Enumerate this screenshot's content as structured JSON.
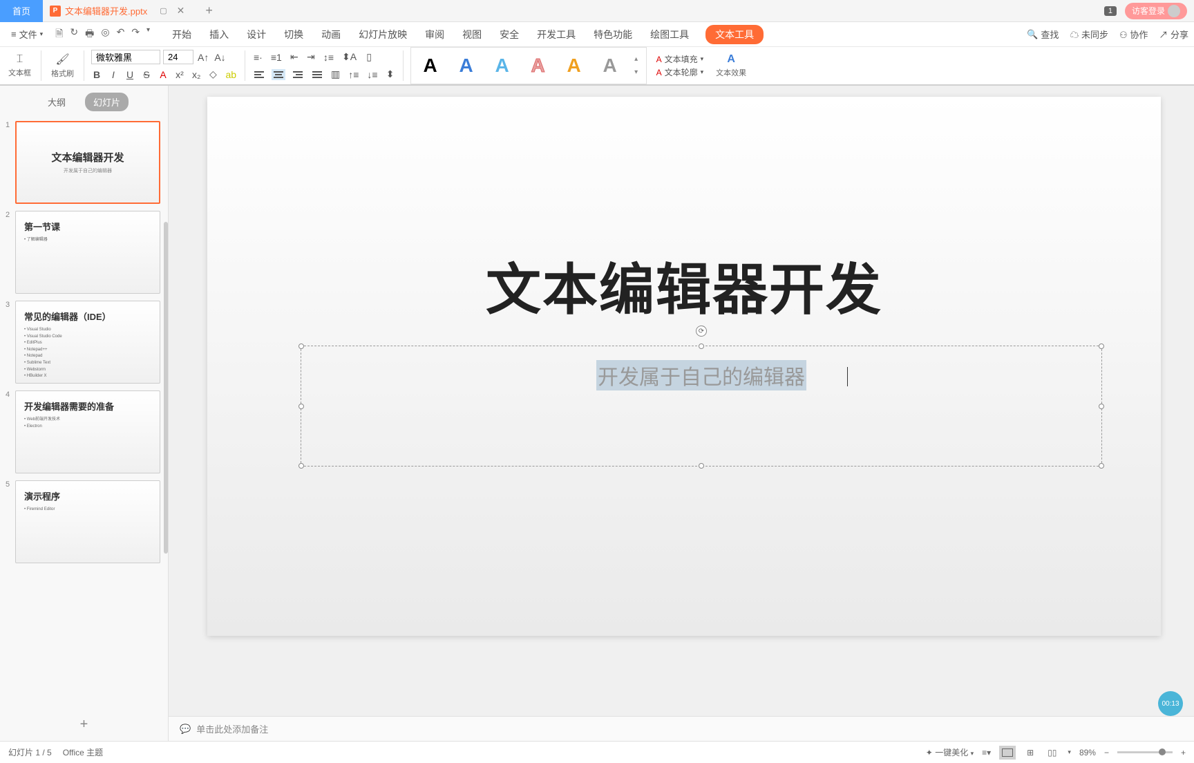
{
  "titlebar": {
    "home": "首页",
    "filename": "文本编辑器开发.pptx",
    "badge": "1",
    "login": "访客登录"
  },
  "menubar": {
    "file": "文件",
    "items": [
      "开始",
      "插入",
      "设计",
      "切换",
      "动画",
      "幻灯片放映",
      "审阅",
      "视图",
      "安全",
      "开发工具",
      "特色功能",
      "绘图工具",
      "文本工具"
    ],
    "search": "查找",
    "sync": "未同步",
    "collab": "协作",
    "share": "分享"
  },
  "toolbar": {
    "textbox": "文本框",
    "format_painter": "格式刷",
    "font_name": "微软雅黑",
    "font_size": "24",
    "text_fill": "文本填充",
    "text_outline": "文本轮廓",
    "text_effects": "文本效果"
  },
  "sidebar": {
    "outline": "大纲",
    "slides": "幻灯片",
    "thumbs": [
      {
        "num": "1",
        "title": "文本编辑器开发",
        "sub": "开发属于自己的编辑器",
        "active": true,
        "layout": "title"
      },
      {
        "num": "2",
        "title": "第一节课",
        "bullets": [
          "• 了解编辑器"
        ],
        "layout": "content"
      },
      {
        "num": "3",
        "title": "常见的编辑器（IDE）",
        "bullets": [
          "• Visual Studio",
          "• Visual Studio Code",
          "• EditPlus",
          "• Notepad++",
          "• Notepad",
          "• Sublime Text",
          "• Webstorm",
          "• HBuilder X"
        ],
        "layout": "content"
      },
      {
        "num": "4",
        "title": "开发编辑器需要的准备",
        "bullets": [
          "• Web前端开发技术",
          "• Electron"
        ],
        "layout": "content"
      },
      {
        "num": "5",
        "title": "演示程序",
        "bullets": [
          "• Firemind Editor"
        ],
        "layout": "content"
      }
    ]
  },
  "slide": {
    "title": "文本编辑器开发",
    "subtitle": "开发属于自己的编辑器"
  },
  "notes": {
    "placeholder": "单击此处添加备注"
  },
  "statusbar": {
    "slide_info": "幻灯片 1 / 5",
    "theme": "Office 主题",
    "beautify": "一键美化",
    "zoom": "89%",
    "timer": "00:13"
  }
}
